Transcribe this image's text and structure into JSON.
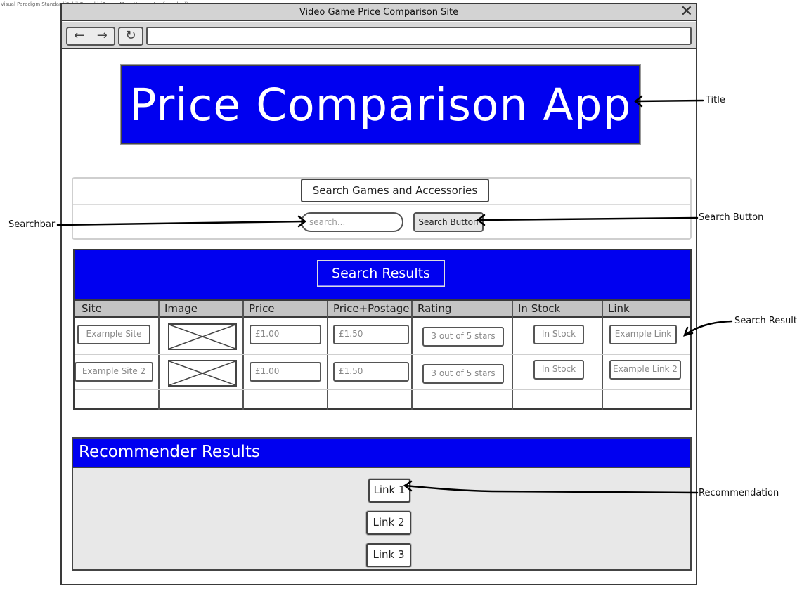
{
  "watermark": "Visual Paradigm Standard(Sahil Qureshi (Queen Mary University of London))",
  "window": {
    "title": "Video Game Price Comparison Site",
    "close_glyph": "✕",
    "back_glyph": "←",
    "forward_glyph": "→",
    "reload_glyph": "↻",
    "url_value": ""
  },
  "banner": {
    "title": "Price Comparison App"
  },
  "search": {
    "heading": "Search Games and Accessories",
    "placeholder": "search...",
    "button_label": "Search Button"
  },
  "results": {
    "title": "Search Results",
    "columns": [
      "Site",
      "Image",
      "Price",
      "Price+Postage",
      "Rating",
      "In Stock",
      "Link"
    ],
    "rows": [
      {
        "site": "Example Site",
        "price": "£1.00",
        "price_postage": "£1.50",
        "rating": "3 out of 5 stars",
        "in_stock": "In Stock",
        "link": "Example Link"
      },
      {
        "site": "Example Site 2",
        "price": "£1.00",
        "price_postage": "£1.50",
        "rating": "3 out of 5 stars",
        "in_stock": "In Stock",
        "link": "Example Link 2"
      }
    ]
  },
  "recommender": {
    "title": "Recommender Results",
    "links": [
      "Link 1",
      "Link 2",
      "Link 3"
    ]
  },
  "annotations": {
    "title": "Title",
    "searchbar": "Searchbar",
    "search_button": "Search Button",
    "search_result": "Search Result",
    "recommendation": "Recommendation"
  },
  "colors": {
    "accent_blue": "#0000f0",
    "chrome_gray": "#d3d3d3",
    "outline": "#3a3a3a"
  }
}
